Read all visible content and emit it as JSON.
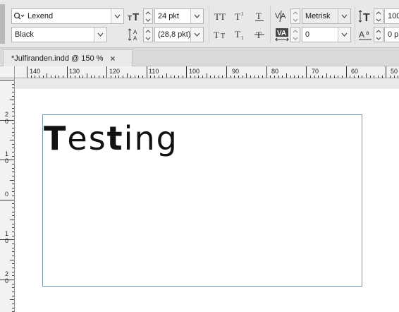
{
  "control_panel": {
    "font_family": "Lexend",
    "font_style": "Black",
    "font_size": "24 pkt",
    "leading": "(28,8 pkt)",
    "kerning": "Metrisk",
    "tracking": "0",
    "vertical_scale": "100",
    "baseline_shift": "0 p"
  },
  "tabs": [
    {
      "label": "*Julfiranden.indd @ 150 %",
      "close_label": "×"
    }
  ],
  "ruler": {
    "horizontal": [
      "140",
      "130",
      "120",
      "110",
      "100",
      "90",
      "80",
      "70",
      "60",
      "50"
    ],
    "vertical": [
      {
        "d1": "2",
        "d2": "0"
      },
      {
        "d1": "1",
        "d2": "0"
      },
      {
        "d1": "0",
        "d2": ""
      },
      {
        "d1": "1",
        "d2": "0"
      },
      {
        "d1": "2",
        "d2": "0"
      }
    ]
  },
  "document": {
    "text_parts": [
      {
        "text": "T",
        "bold": true
      },
      {
        "text": "es",
        "bold": false
      },
      {
        "text": "t",
        "bold": true
      },
      {
        "text": "ing",
        "bold": false
      }
    ]
  }
}
